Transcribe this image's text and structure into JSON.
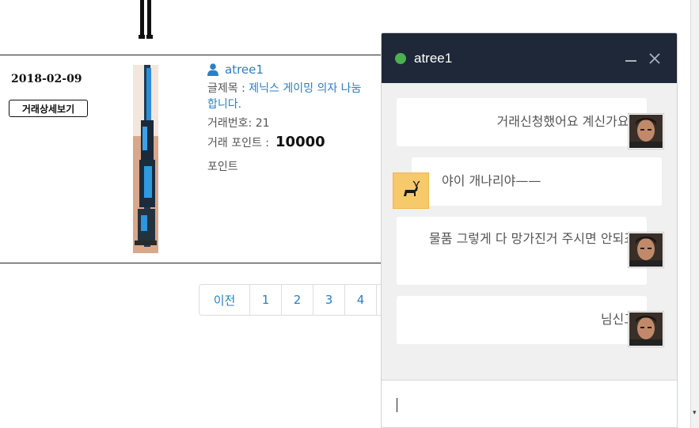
{
  "trade": {
    "date": "2018-02-09",
    "detail_button": "거래상세보기",
    "seller": "atree1",
    "subject_label": "글제목 : ",
    "subject": "제닉스 게이밍 의자 나눔합니다.",
    "trade_no_label": "거래번호: ",
    "trade_no": "21",
    "points_label": "거래 포인트 :",
    "points": "10000",
    "points_unit": "포인트"
  },
  "pagination": {
    "prev": "이전",
    "pages": [
      "1",
      "2",
      "3",
      "4"
    ]
  },
  "chat": {
    "title": "atree1",
    "status_color": "#4caf50",
    "header_color": "#1f2838",
    "messages": [
      {
        "text": "거래신청했어요 계신가요?",
        "side": "mine"
      },
      {
        "text": "야이 개나리야——",
        "side": "theirs"
      },
      {
        "text": "물품 그렇게 다 망가진거 주시면 안되죠",
        "side": "mine"
      },
      {
        "text": "님신고",
        "side": "mine"
      }
    ],
    "input_value": ""
  },
  "colors": {
    "link": "#2a7fc9"
  },
  "icons": {
    "user": "user-icon",
    "minimize": "minimize-icon",
    "close": "close-icon"
  }
}
